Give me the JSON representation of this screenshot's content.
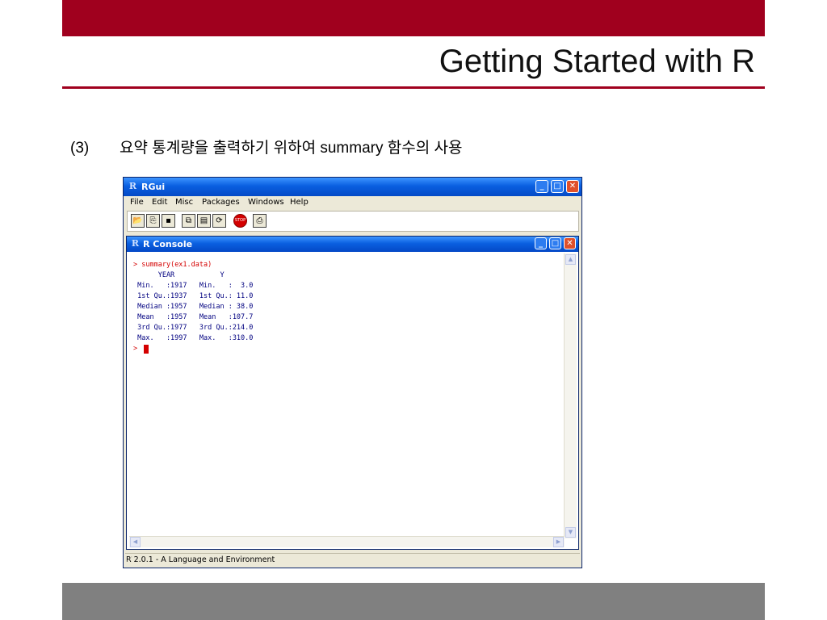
{
  "slide": {
    "title": "Getting Started with R",
    "bullet_number": "(3)",
    "bullet_text": "요약 통계량을 출력하기 위하여 summary 함수의 사용",
    "colors": {
      "accent": "#a0001e",
      "footer": "#808080"
    }
  },
  "rgui": {
    "title": "RGui",
    "menu": [
      "File",
      "Edit",
      "Misc",
      "Packages",
      "Windows",
      "Help"
    ],
    "toolbar_icons": [
      "open-script-icon",
      "load-workspace-icon",
      "save-icon",
      "copy-icon",
      "paste-icon",
      "copy-paste-icon",
      "stop-icon",
      "print-icon"
    ],
    "stop_label": "STOP",
    "console": {
      "title": "R Console",
      "prompt": ">",
      "command": "summary(ex1.data)",
      "output": [
        "      YEAR           Y        ",
        " Min.   :1917   Min.   :  3.0  ",
        " 1st Qu.:1937   1st Qu.: 11.0  ",
        " Median :1957   Median : 38.0  ",
        " Mean   :1957   Mean   :107.7  ",
        " 3rd Qu.:1977   3rd Qu.:214.0  ",
        " Max.   :1997   Max.   :310.0  "
      ]
    },
    "status_text": "R 2.0.1 - A Language and Environment"
  }
}
